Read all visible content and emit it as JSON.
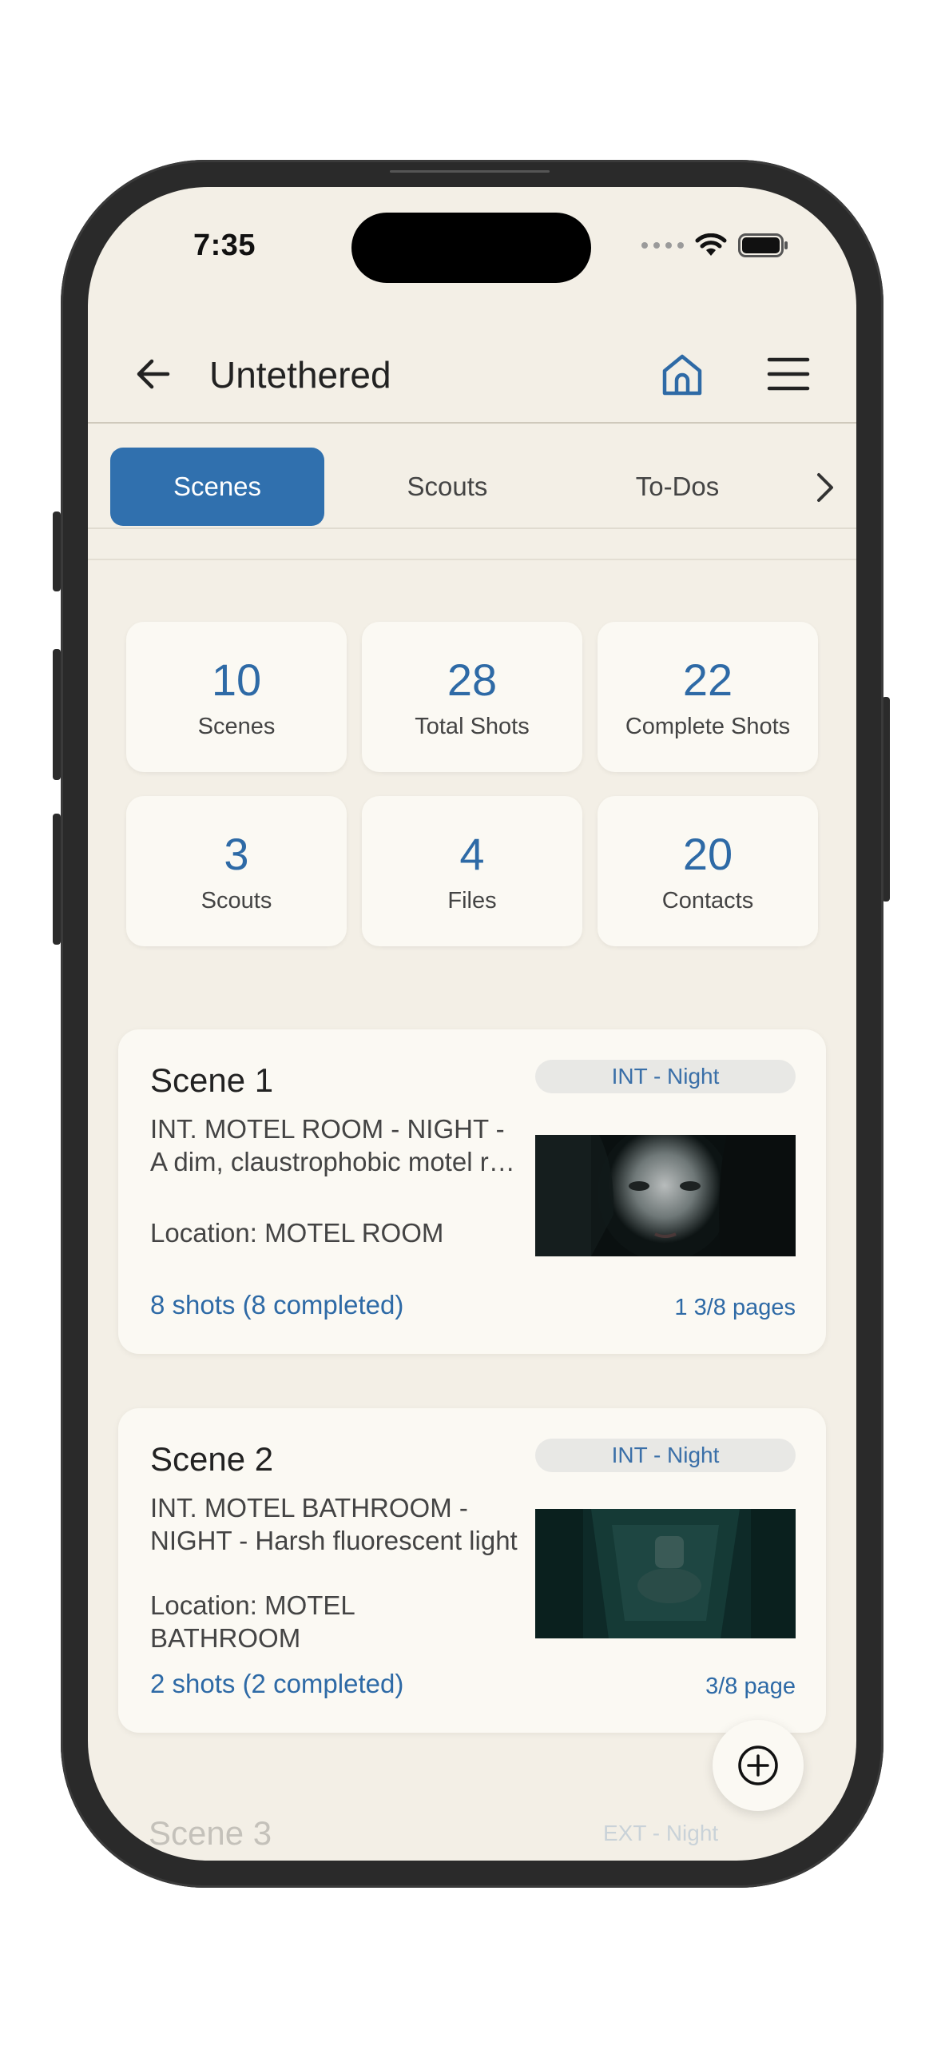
{
  "status_bar": {
    "time": "7:35"
  },
  "header": {
    "title": "Untethered"
  },
  "tabs": [
    {
      "label": "Scenes",
      "active": true
    },
    {
      "label": "Scouts",
      "active": false
    },
    {
      "label": "To-Dos",
      "active": false
    }
  ],
  "stats": [
    {
      "value": "10",
      "label": "Scenes"
    },
    {
      "value": "28",
      "label": "Total Shots"
    },
    {
      "value": "22",
      "label": "Complete Shots"
    },
    {
      "value": "3",
      "label": "Scouts"
    },
    {
      "value": "4",
      "label": "Files"
    },
    {
      "value": "20",
      "label": "Contacts"
    }
  ],
  "scenes": [
    {
      "title": "Scene 1",
      "badge": "INT - Night",
      "desc_line1": "INT. MOTEL ROOM - NIGHT -",
      "desc_line2": "A dim, claustrophobic motel room",
      "location": "Location: MOTEL ROOM",
      "shots": "8 shots (8 completed)",
      "pages": "1 3/8 pages"
    },
    {
      "title": "Scene 2",
      "badge": "INT - Night",
      "desc_line1": "INT. MOTEL BATHROOM -",
      "desc_line2": "NIGHT - Harsh fluorescent light",
      "location_line1": "Location: MOTEL",
      "location_line2": "BATHROOM",
      "shots": "2 shots (2 completed)",
      "pages": "3/8 page"
    },
    {
      "title": "Scene 3",
      "badge": "EXT - Night"
    }
  ],
  "colors": {
    "accent": "#3070ae",
    "background": "#f3efe6",
    "card": "#fbf9f3"
  }
}
